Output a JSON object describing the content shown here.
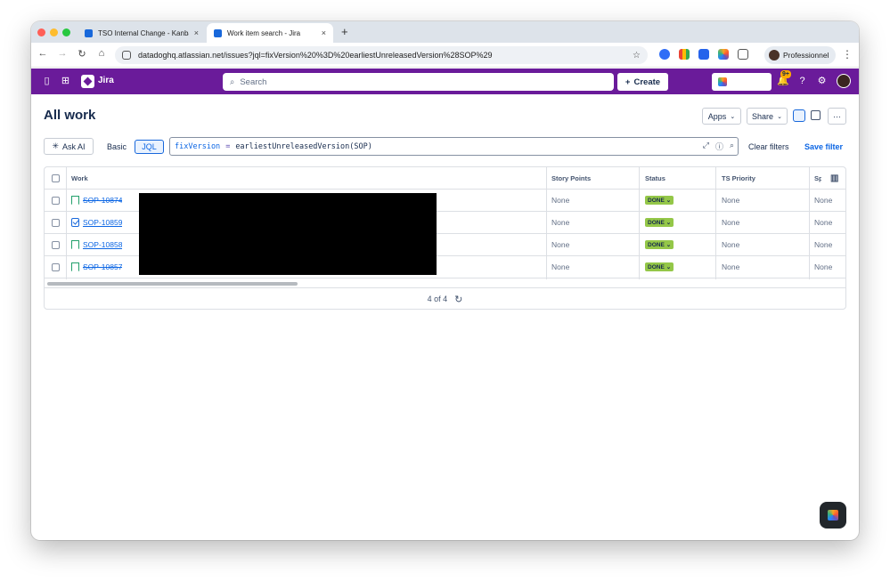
{
  "browser": {
    "tabs": [
      {
        "title": "TSO Internal Change - Kanban",
        "close": "×"
      },
      {
        "title": "Work item search - Jira",
        "close": "×"
      }
    ],
    "new_tab": "+",
    "url": "datadoghq.atlassian.net/issues?jql=fixVersion%20%3D%20earliestUnreleasedVersion%28SOP%29",
    "profile_label": "Professionnel"
  },
  "jira_nav": {
    "product": "Jira",
    "search_placeholder": "Search",
    "create_label": "Create",
    "notification_count": "9+"
  },
  "page": {
    "title": "All work",
    "apps_label": "Apps",
    "share_label": "Share",
    "more_label": "···"
  },
  "query": {
    "ask_ai": "Ask AI",
    "basic": "Basic",
    "jql": "JQL",
    "jql_field": "fixVersion",
    "jql_operator": "=",
    "jql_value": "earliestUnreleasedVersion(SOP)",
    "clear_filters": "Clear filters",
    "save_filter": "Save filter"
  },
  "table": {
    "columns": [
      "Work",
      "Story Points",
      "Status",
      "TS Priority",
      "Sp"
    ],
    "rows": [
      {
        "key": "SOP-10874",
        "type": "story",
        "story_points": "None",
        "status": "DONE",
        "ts_priority": "None",
        "sp": "None"
      },
      {
        "key": "SOP-10859",
        "type": "task",
        "story_points": "None",
        "status": "DONE",
        "ts_priority": "None",
        "sp": "None"
      },
      {
        "key": "SOP-10858",
        "type": "story",
        "story_points": "None",
        "status": "DONE",
        "ts_priority": "None",
        "sp": "None"
      },
      {
        "key": "SOP-10857",
        "type": "story",
        "story_points": "None",
        "status": "DONE",
        "ts_priority": "None",
        "sp": "None"
      }
    ],
    "pagination": "4 of 4"
  },
  "colors": {
    "jira_nav_bg": "#6a1b9a",
    "status_done": "#94c748",
    "link": "#0c66e4"
  }
}
